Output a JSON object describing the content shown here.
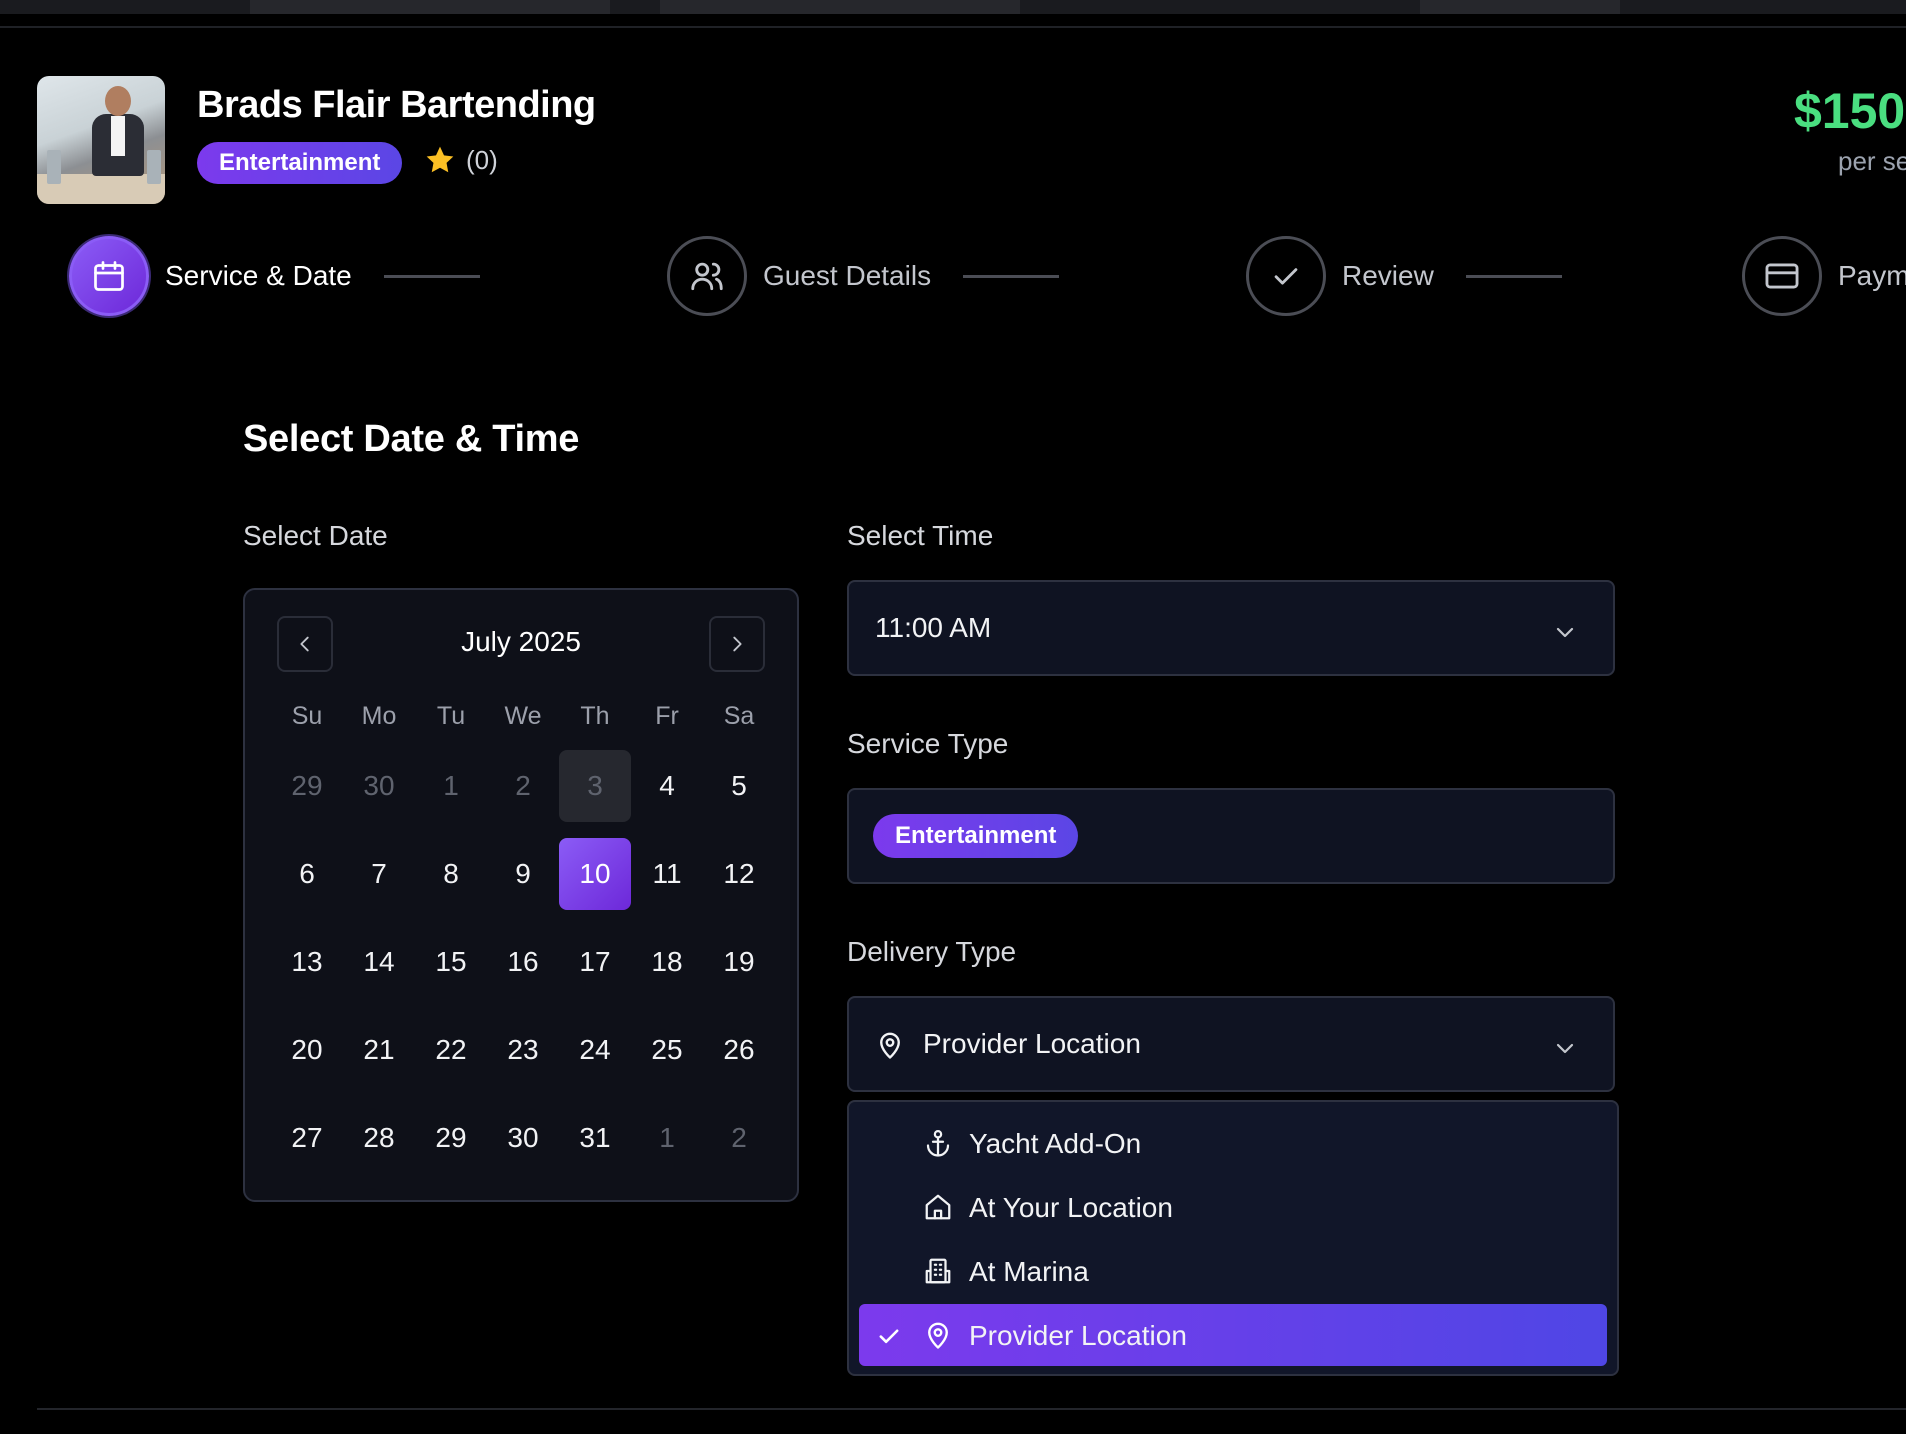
{
  "header": {
    "business_name": "Brads Flair Bartending",
    "category": "Entertainment",
    "rating_count": "(0)",
    "price": "$150",
    "price_unit": "per se"
  },
  "steps": [
    {
      "label": "Service & Date",
      "icon": "calendar-icon",
      "active": true
    },
    {
      "label": "Guest Details",
      "icon": "users-icon",
      "active": false
    },
    {
      "label": "Review",
      "icon": "check-icon",
      "active": false
    },
    {
      "label": "Paym",
      "icon": "credit-card-icon",
      "active": false
    }
  ],
  "section": {
    "title": "Select Date & Time",
    "date_label": "Select Date",
    "time_label": "Select Time",
    "service_type_label": "Service Type",
    "delivery_type_label": "Delivery Type"
  },
  "calendar": {
    "month": "July 2025",
    "weekdays": [
      "Su",
      "Mo",
      "Tu",
      "We",
      "Th",
      "Fr",
      "Sa"
    ],
    "weeks": [
      [
        "29",
        "30",
        "1",
        "2",
        "3",
        "4",
        "5"
      ],
      [
        "6",
        "7",
        "8",
        "9",
        "10",
        "11",
        "12"
      ],
      [
        "13",
        "14",
        "15",
        "16",
        "17",
        "18",
        "19"
      ],
      [
        "20",
        "21",
        "22",
        "23",
        "24",
        "25",
        "26"
      ],
      [
        "27",
        "28",
        "29",
        "30",
        "31",
        "1",
        "2"
      ]
    ],
    "selected_day": "10",
    "today": "3"
  },
  "time": {
    "value": "11:00 AM"
  },
  "service_type": {
    "badge": "Entertainment"
  },
  "delivery_type": {
    "value": "Provider Location",
    "options": [
      {
        "label": "Yacht Add-On",
        "icon": "anchor-icon"
      },
      {
        "label": "At Your Location",
        "icon": "home-icon"
      },
      {
        "label": "At Marina",
        "icon": "building-icon"
      },
      {
        "label": "Provider Location",
        "icon": "map-pin-icon",
        "selected": true
      }
    ]
  },
  "colors": {
    "accent": "#7c3aed",
    "accent_end": "#4f46e5",
    "price": "#4ade80",
    "background": "#000000",
    "panel": "#0f1322"
  }
}
